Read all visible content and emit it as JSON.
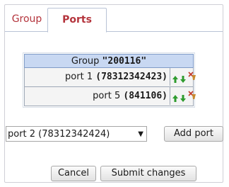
{
  "tabs": [
    {
      "label": "Group"
    },
    {
      "label": "Ports"
    }
  ],
  "group_table": {
    "header_prefix": "Group",
    "group_id": "\"200116\"",
    "rows": [
      {
        "name": "port 1",
        "number": "(78312342423)"
      },
      {
        "name": "port 5",
        "number": "(841106)"
      }
    ]
  },
  "add_port": {
    "select_value": "port 2 (78312342424)",
    "add_label": "Add port"
  },
  "footer": {
    "cancel_label": "Cancel",
    "submit_label": "Submit changes"
  },
  "icons": {
    "move_up": "arrow-up-icon",
    "move_down": "arrow-down-icon",
    "delete": "delete-icon"
  },
  "colors": {
    "tab_text": "#b4343c",
    "header_bg": "#c8d8f2",
    "arrow_green": "#2e9b2e"
  }
}
